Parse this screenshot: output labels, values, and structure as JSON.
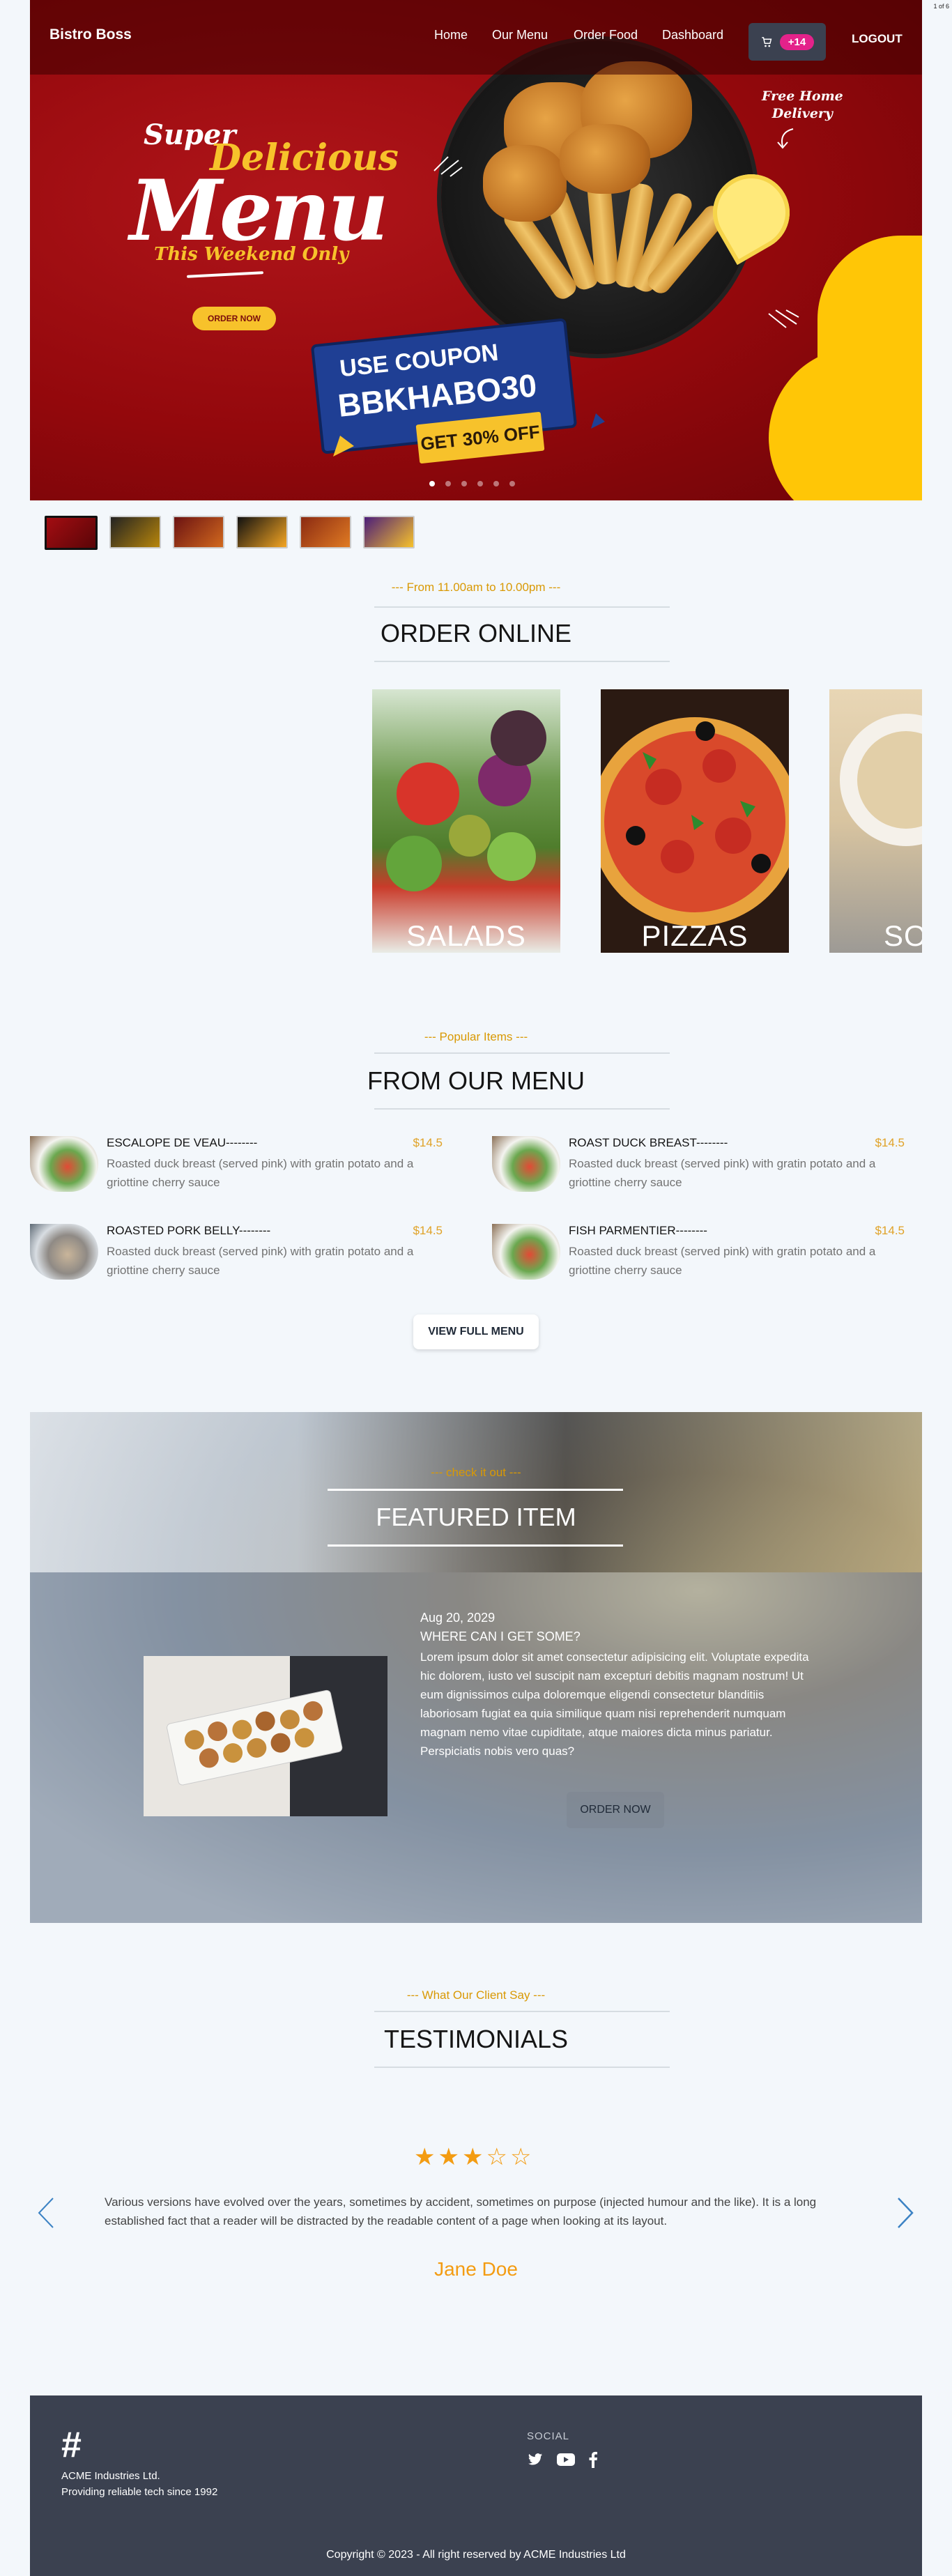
{
  "page_indicator": "1 of 6",
  "nav": {
    "brand": "Bistro Boss",
    "links": [
      "Home",
      "Our Menu",
      "Order Food",
      "Dashboard"
    ],
    "cart_badge": "+14",
    "logout": "LOGOUT"
  },
  "hero": {
    "super": "Super",
    "delicious": "Delicious",
    "menu": "Menu",
    "weekend": "This Weekend Only",
    "order_now": "ORDER NOW",
    "coupon_line1": "USE COUPON",
    "coupon_code": "BBKHABO30",
    "discount": "GET 30% OFF",
    "free_delivery_line1": "Free Home",
    "free_delivery_line2": "Delivery",
    "slide_count": 6,
    "active_slide": 0
  },
  "order_online": {
    "subtitle": "--- From 11.00am to 10.00pm ---",
    "title": "ORDER ONLINE",
    "categories": [
      "SALADS",
      "PIZZAS",
      "SO"
    ]
  },
  "from_menu": {
    "subtitle": "--- Popular Items ---",
    "title": "FROM OUR MENU",
    "items": [
      {
        "name": "ESCALOPE DE VEAU--------",
        "price": "$14.5",
        "desc": "Roasted duck breast (served pink) with gratin potato and a griottine cherry sauce"
      },
      {
        "name": "ROAST DUCK BREAST--------",
        "price": "$14.5",
        "desc": "Roasted duck breast (served pink) with gratin potato and a griottine cherry sauce"
      },
      {
        "name": "ROASTED PORK BELLY--------",
        "price": "$14.5",
        "desc": "Roasted duck breast (served pink) with gratin potato and a griottine cherry sauce"
      },
      {
        "name": "FISH PARMENTIER--------",
        "price": "$14.5",
        "desc": "Roasted duck breast (served pink) with gratin potato and a griottine cherry sauce"
      }
    ],
    "view_full_menu": "VIEW FULL MENU"
  },
  "featured": {
    "subtitle": "--- check it out ---",
    "title": "FEATURED ITEM",
    "date": "Aug 20, 2029",
    "question": "WHERE CAN I GET SOME?",
    "body": "Lorem ipsum dolor sit amet consectetur adipisicing elit. Voluptate expedita hic dolorem, iusto vel suscipit nam excepturi debitis magnam nostrum! Ut eum dignissimos culpa doloremque eligendi consectetur blanditiis laboriosam fugiat ea quia similique quam nisi reprehenderit numquam magnam nemo vitae cupiditate, atque maiores dicta minus pariatur. Perspiciatis nobis vero quas?",
    "order_now": "ORDER NOW"
  },
  "testimonials": {
    "subtitle": "--- What Our Client Say ---",
    "title": "TESTIMONIALS",
    "rating": 3,
    "max_rating": 5,
    "quote": "Various versions have evolved over the years, sometimes by accident, sometimes on purpose (injected humour and the like). It is a long established fact that a reader will be distracted by the readable content of a page when looking at its layout.",
    "client": "Jane Doe"
  },
  "footer": {
    "company": "ACME Industries Ltd.",
    "tagline": "Providing reliable tech since 1992",
    "social_heading": "SOCIAL",
    "social_icons": [
      "twitter-icon",
      "youtube-icon",
      "facebook-icon"
    ],
    "copyright": "Copyright © 2023 - All right reserved by ACME Industries Ltd"
  },
  "colors": {
    "accent_gold": "#d99904",
    "hero_red": "#93080c",
    "hero_yellow": "#ffc606",
    "badge_pink": "#e4228a",
    "footer_bg": "#3b4150",
    "star_orange": "#f39c12"
  }
}
